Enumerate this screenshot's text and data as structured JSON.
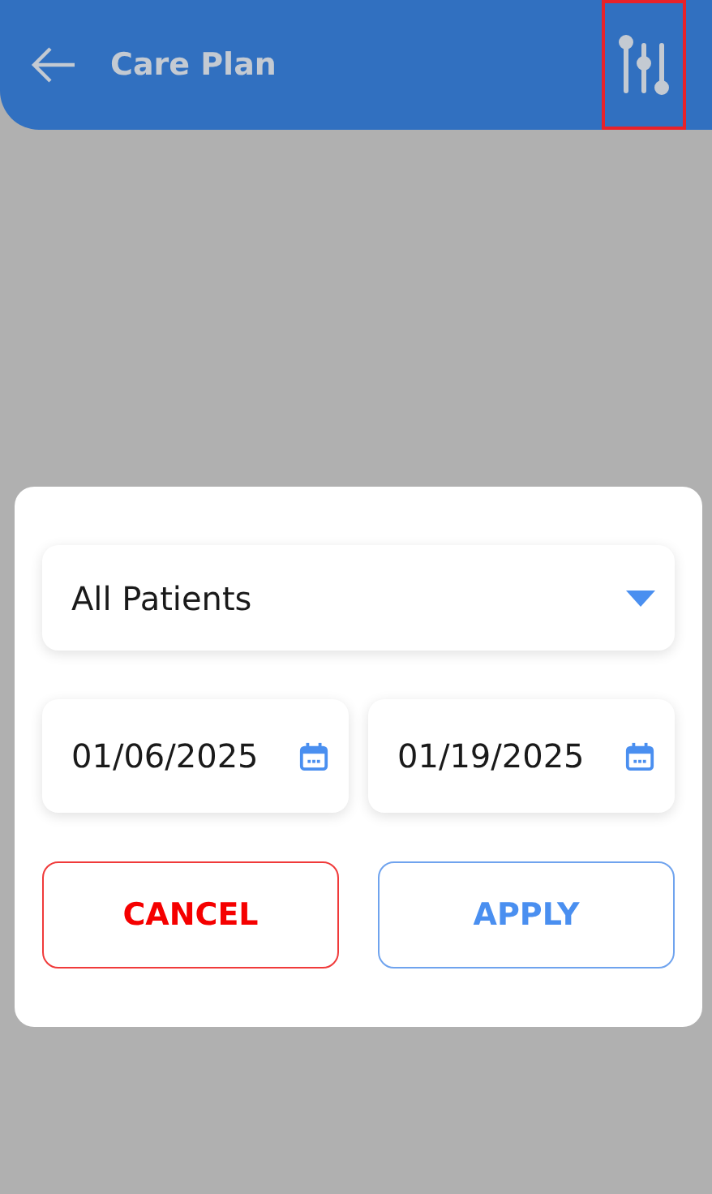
{
  "header": {
    "title": "Care Plan",
    "filter_button": {
      "highlighted": true
    }
  },
  "dialog": {
    "patient_select": {
      "value": "All Patients"
    },
    "dates": [
      {
        "value": "01/06/2025"
      },
      {
        "value": "01/19/2025"
      }
    ],
    "buttons": [
      {
        "label": "CANCEL",
        "kind": "cancel"
      },
      {
        "label": "APPLY",
        "kind": "apply"
      }
    ]
  }
}
